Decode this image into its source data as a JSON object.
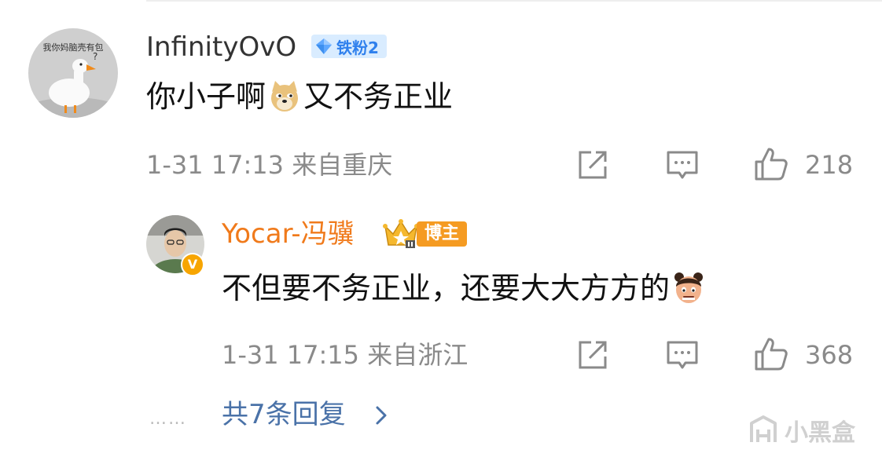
{
  "comment": {
    "username": "InfinityOvO",
    "fan_badge": "铁粉2",
    "avatar_caption": "我你妈脑壳有包",
    "text_before_emoji": "你小子啊",
    "text_after_emoji": "又不务正业",
    "timestamp": "1-31 17:13",
    "location": "来自重庆",
    "like_count": "218"
  },
  "reply": {
    "username": "Yocar-冯骥",
    "verified_mark": "V",
    "role_badge": "博主",
    "text": "不但要不务正业，还要大大方方的",
    "timestamp": "1-31 17:15",
    "location": "来自浙江",
    "like_count": "368"
  },
  "footer": {
    "dots": "……",
    "more_replies_label": "共7条回复"
  },
  "watermark": {
    "label": "小黑盒"
  },
  "icons": {
    "share": "share-icon",
    "comment": "comment-icon",
    "like": "like-icon",
    "chevron": "chevron-right-icon",
    "diamond": "diamond-icon",
    "crown": "crown-icon",
    "emoji_doge": "doge-emoji-icon",
    "emoji_girl": "girl-emoji-icon"
  },
  "colors": {
    "reply_username": "#f07a1b",
    "link": "#4a72a8",
    "meta_gray": "#8a8a8a",
    "fan_badge_bg": "#d9ecff",
    "blogger_badge_bg": "#f59b22"
  }
}
